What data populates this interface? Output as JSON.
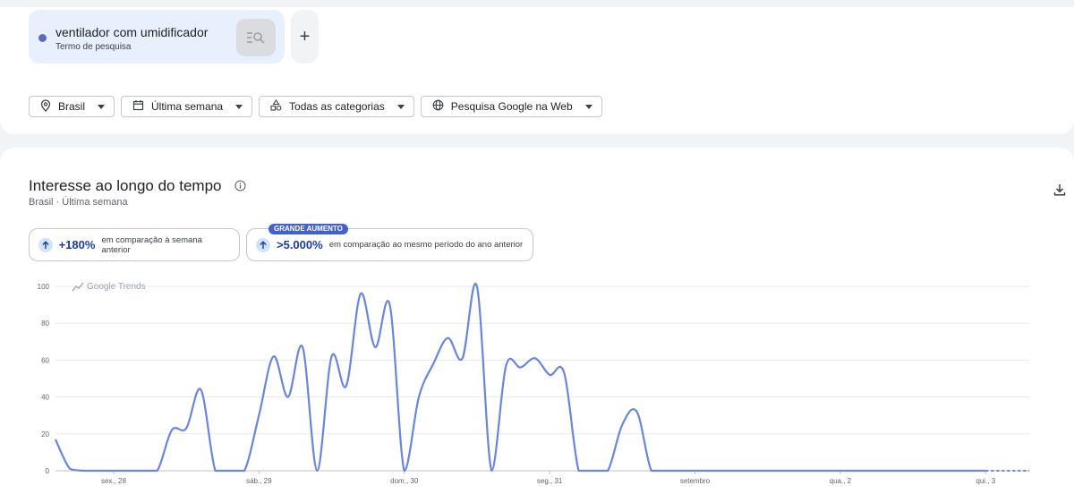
{
  "search": {
    "term": "ventilador com umidificador",
    "term_type": "Termo de pesquisa",
    "term_color": "#5c6bc0",
    "add_label": "+"
  },
  "filters": [
    {
      "icon": "location-pin-icon",
      "label": "Brasil"
    },
    {
      "icon": "calendar-icon",
      "label": "Última semana"
    },
    {
      "icon": "categories-icon",
      "label": "Todas as categorias"
    },
    {
      "icon": "globe-icon",
      "label": "Pesquisa Google na Web"
    }
  ],
  "section": {
    "title": "Interesse ao longo do tempo",
    "subtitle": "Brasil · Última semana"
  },
  "stats": [
    {
      "value": "+180%",
      "description": "em comparação à semana anterior"
    },
    {
      "value": ">5.000%",
      "description": "em comparação ao mesmo período do ano anterior",
      "badge": "GRANDE AUMENTO"
    }
  ],
  "chart_data": {
    "type": "line",
    "watermark": "Google Trends",
    "line_color": "#6b85d8",
    "ylim": [
      0,
      100
    ],
    "yticks": [
      0,
      20,
      40,
      60,
      80,
      100
    ],
    "xtick_labels": [
      {
        "label": "sex., 28",
        "index": 4
      },
      {
        "label": "sáb., 29",
        "index": 14
      },
      {
        "label": "dom., 30",
        "index": 24
      },
      {
        "label": "seg., 31",
        "index": 34
      },
      {
        "label": "setembro",
        "index": 44
      },
      {
        "label": "qua., 2",
        "index": 54
      },
      {
        "label": "qui., 3",
        "index": 64
      }
    ],
    "values": [
      17,
      1,
      0,
      0,
      0,
      0,
      0,
      0,
      22,
      23,
      44,
      0,
      0,
      0,
      30,
      62,
      40,
      67,
      0,
      62,
      46,
      96,
      67,
      90,
      0,
      40,
      58,
      72,
      61,
      100,
      0,
      57,
      56,
      61,
      52,
      53,
      0,
      0,
      0,
      25,
      32,
      0,
      0,
      0,
      0,
      0,
      0,
      0,
      0,
      0,
      0,
      0,
      0,
      0,
      0,
      0,
      0,
      0,
      0,
      0,
      0,
      0,
      0,
      0,
      0,
      0,
      0,
      0
    ],
    "partial_from_index": 64
  }
}
